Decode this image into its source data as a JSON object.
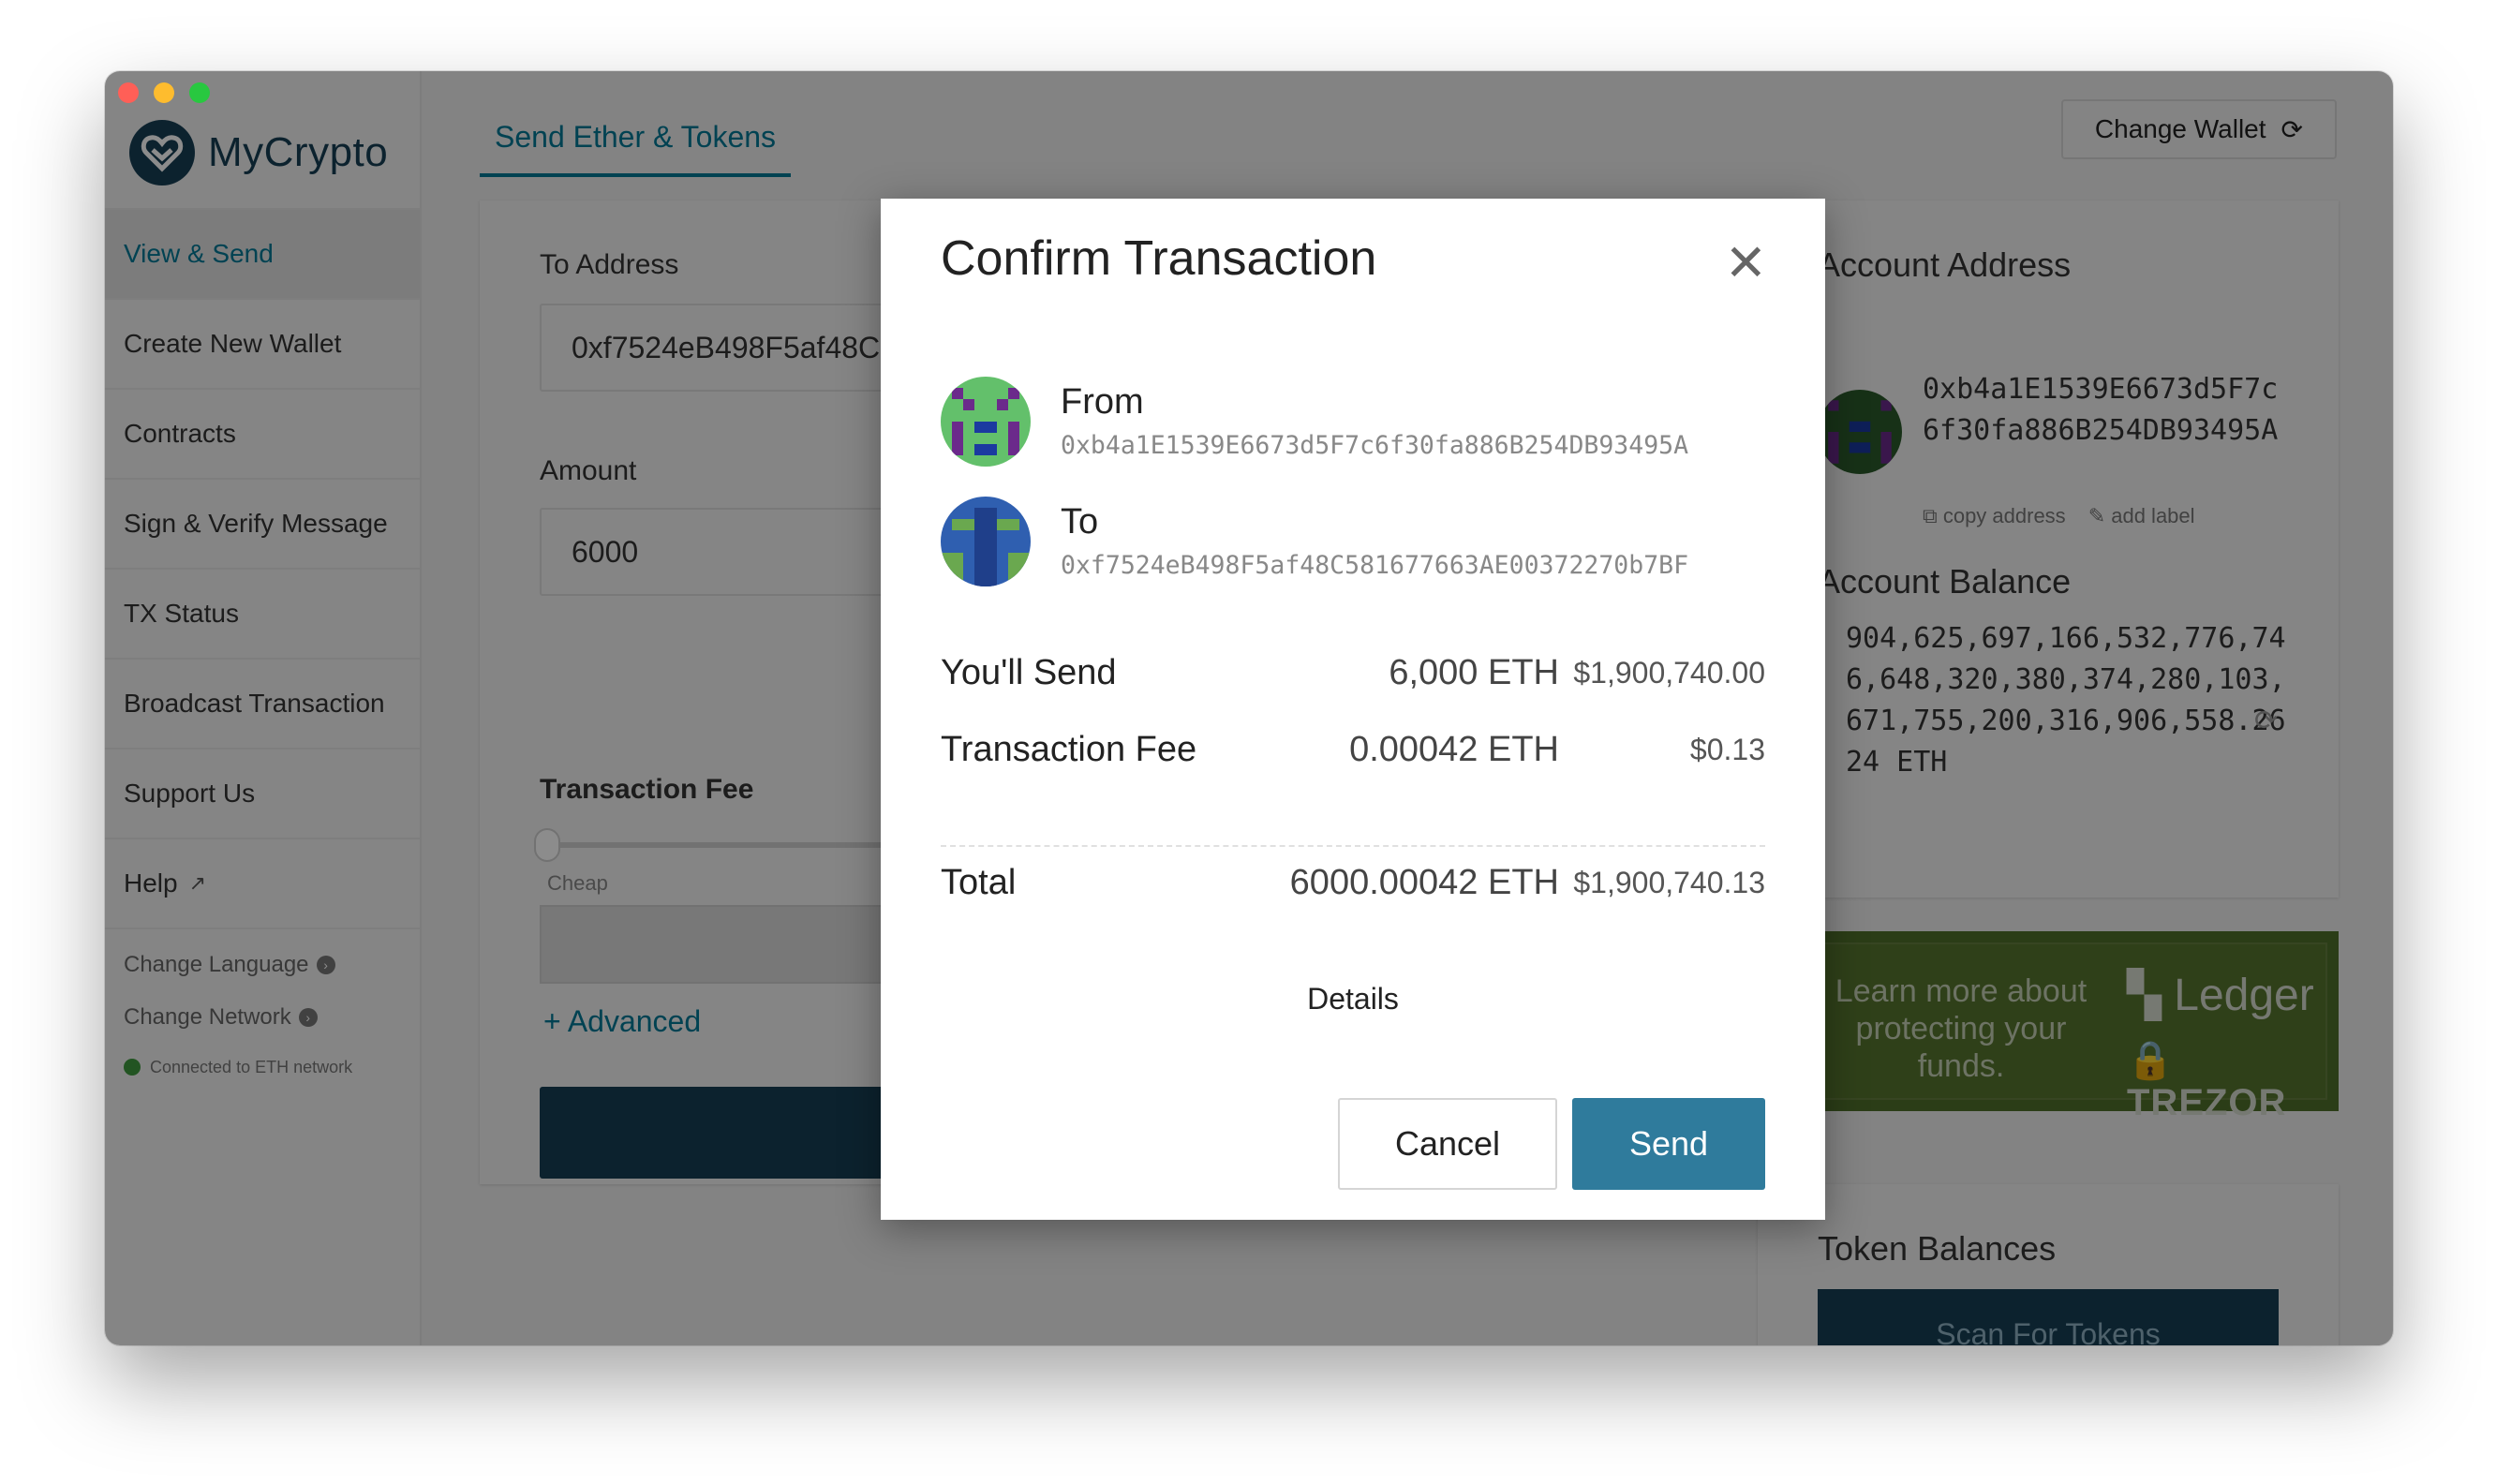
{
  "app": {
    "name": "MyCrypto"
  },
  "sidebar": {
    "items": [
      {
        "label": "View & Send"
      },
      {
        "label": "Create New Wallet"
      },
      {
        "label": "Contracts"
      },
      {
        "label": "Sign & Verify Message"
      },
      {
        "label": "TX Status"
      },
      {
        "label": "Broadcast Transaction"
      },
      {
        "label": "Support Us"
      },
      {
        "label": "Help"
      }
    ],
    "change_language": "Change Language",
    "change_network": "Change Network",
    "network_status": "Connected to ETH network"
  },
  "header": {
    "tabs": [
      {
        "label": "Send Ether & Tokens"
      }
    ],
    "change_wallet_label": "Change Wallet"
  },
  "send_form": {
    "to_address_label": "To Address",
    "to_address_value": "0xf7524eB498F5af48C581677663AE00372270b7BF",
    "amount_label": "Amount",
    "amount_value": "6000",
    "fee_label": "Transaction Fee",
    "fee_slider_label": "Cheap",
    "advanced_label": "+ Advanced"
  },
  "account": {
    "address_title": "Account Address",
    "address": "0xb4a1E1539E6673d5F7c6f30fa886B254DB93495A",
    "copy_label": "copy address",
    "add_label": "add label",
    "balance_title": "Account Balance",
    "balance": "904,625,697,166,532,776,746,648,320,380,374,280,103,671,755,200,316,906,558.2624 ETH"
  },
  "promo": {
    "text": "Learn more about protecting your funds.",
    "brand_ledger": "Ledger",
    "brand_trezor": "TREZOR"
  },
  "tokens": {
    "title": "Token Balances",
    "scan_label": "Scan For Tokens"
  },
  "modal": {
    "title": "Confirm Transaction",
    "from_label": "From",
    "from_address": "0xb4a1E1539E6673d5F7c6f30fa886B254DB93495A",
    "to_label": "To",
    "to_address": "0xf7524eB498F5af48C581677663AE00372270b7BF",
    "send_row": {
      "label": "You'll Send",
      "eth": "6,000 ETH",
      "usd": "$1,900,740.00"
    },
    "fee_row": {
      "label": "Transaction Fee",
      "eth": "0.00042 ETH",
      "usd": "$0.13"
    },
    "total_row": {
      "label": "Total",
      "eth": "6000.00042 ETH",
      "usd": "$1,900,740.13"
    },
    "details_label": "Details",
    "cancel_label": "Cancel",
    "send_label": "Send"
  },
  "colors": {
    "accent": "#007896",
    "primary_dark": "#163f55",
    "send_button": "#2f7b9c",
    "promo_green": "#57752e"
  },
  "icons": [
    "mycrypto-logo-icon",
    "refresh-icon",
    "external-link-icon",
    "arrow-circle-icon",
    "copy-icon",
    "pencil-icon",
    "close-icon",
    "identicon"
  ]
}
